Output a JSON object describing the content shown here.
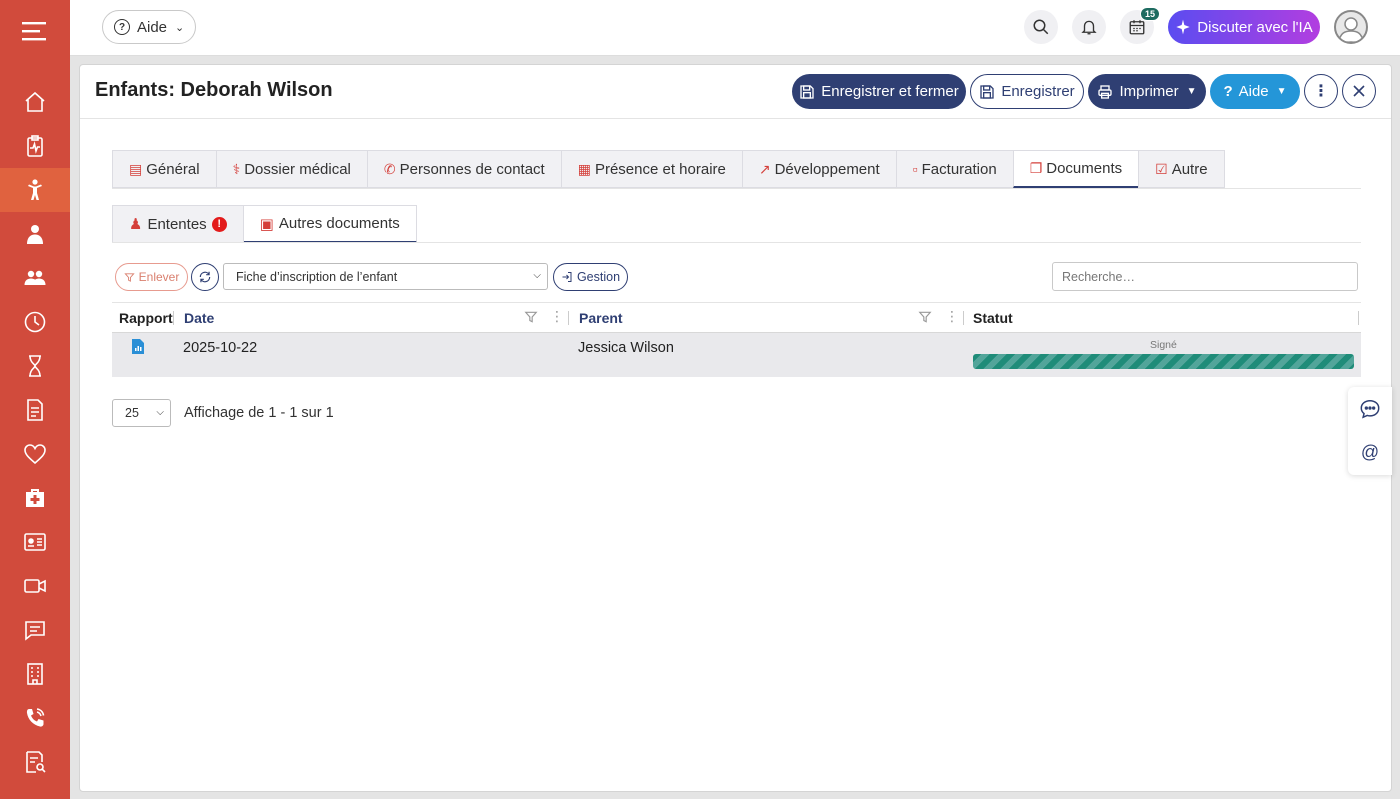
{
  "topbar": {
    "help_label": "Aide",
    "ai_label": "Discuter avec l'IA",
    "calendar_badge": "15"
  },
  "panel": {
    "title": "Enfants: Deborah Wilson",
    "buttons": {
      "save_close": "Enregistrer et fermer",
      "save": "Enregistrer",
      "print": "Imprimer",
      "help": "Aide"
    }
  },
  "tabs": [
    {
      "label": "Général",
      "icon": "list-icon"
    },
    {
      "label": "Dossier médical",
      "icon": "stethoscope-icon"
    },
    {
      "label": "Personnes de contact",
      "icon": "phone-icon"
    },
    {
      "label": "Présence et horaire",
      "icon": "calendar-icon"
    },
    {
      "label": "Développement",
      "icon": "chart-line-icon"
    },
    {
      "label": "Facturation",
      "icon": "invoice-icon"
    },
    {
      "label": "Documents",
      "icon": "documents-icon"
    },
    {
      "label": "Autre",
      "icon": "checkbox-icon"
    }
  ],
  "active_tab": "Documents",
  "subtabs": [
    {
      "label": "Ententes",
      "icon": "users-icon",
      "alert": "!"
    },
    {
      "label": "Autres documents",
      "icon": "document-icon"
    }
  ],
  "toolbar": {
    "remove_label": "Enlever",
    "select_value": "Fiche d’inscription de l’enfant",
    "gestion_label": "Gestion",
    "search_placeholder": "Recherche…"
  },
  "grid": {
    "columns": [
      "Rapport",
      "Date",
      "Parent",
      "Statut"
    ],
    "rows": [
      {
        "date": "2025-10-22",
        "parent": "Jessica Wilson",
        "status": "Signé",
        "status_color": "#1f8c79"
      }
    ]
  },
  "pager": {
    "page_size": "25",
    "summary": "Affichage de 1 - 1 sur 1"
  },
  "colors": {
    "sidebar": "#d14b3c",
    "primary": "#2f3f73",
    "accent_blue": "#2496d8"
  }
}
